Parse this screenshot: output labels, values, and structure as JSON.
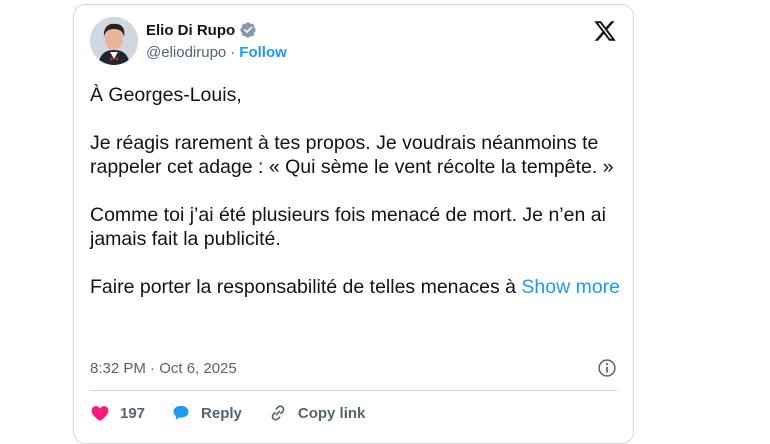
{
  "author": {
    "name": "Elio Di Rupo",
    "handle": "@eliodirupo",
    "separator": "·",
    "follow_label": "Follow"
  },
  "tweet": {
    "text": "À Georges-Louis,\n\nJe réagis rarement à tes propos. Je voudrais néanmoins te rappeler cet adage : « Qui sème le vent récolte la tempête. »\n\nComme toi j’ai été plusieurs fois menacé de mort. Je n’en ai jamais fait la publicité.\n\nFaire porter la responsabilité de telles menaces à ",
    "show_more": "Show more",
    "timestamp": "8:32 PM · Oct 6, 2025"
  },
  "actions": {
    "like_count": "197",
    "reply_label": "Reply",
    "copy_link_label": "Copy link"
  },
  "colors": {
    "accent": "#1d9bf0",
    "like": "#f91880",
    "verified": "#829aab",
    "muted": "#536471"
  },
  "icons": [
    "verified-badge-icon",
    "x-logo-icon",
    "info-icon",
    "heart-icon",
    "reply-bubble-icon",
    "link-icon"
  ]
}
